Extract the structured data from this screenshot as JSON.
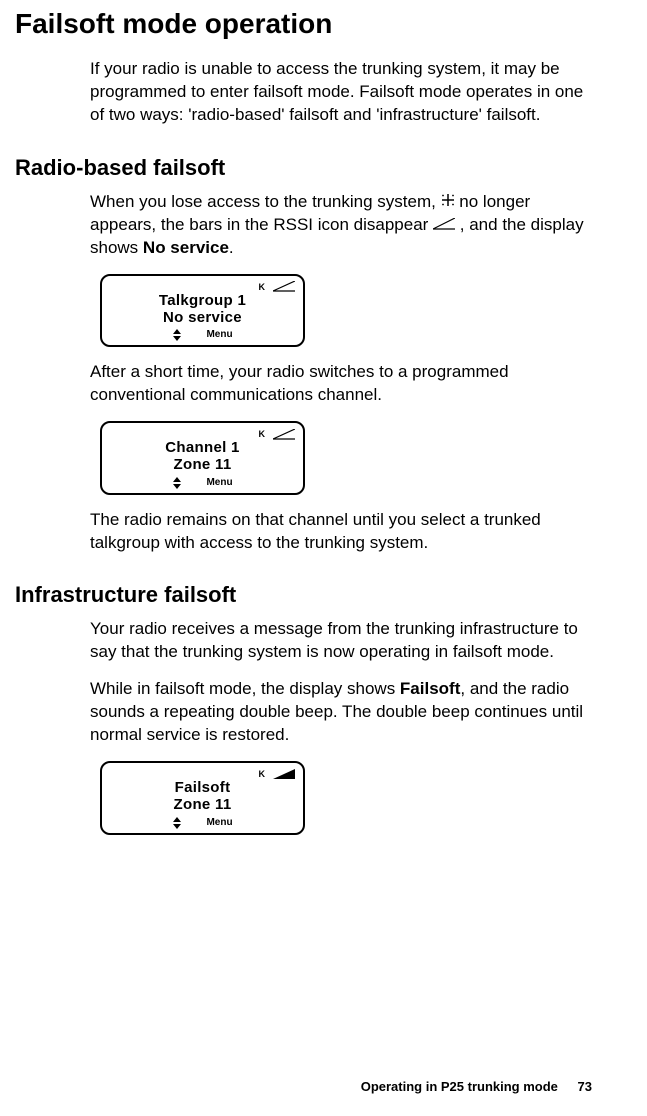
{
  "heading_main": "Failsoft mode operation",
  "intro_paragraph": "If your radio is unable to access the trunking system, it may be programmed to enter failsoft mode. Failsoft mode operates in one of two ways: 'radio-based' failsoft and 'infrastructure' failsoft.",
  "section1": {
    "heading": "Radio-based failsoft",
    "p1_pre": "When you lose access to the trunking system, ",
    "p1_mid": " no longer appears, the bars in the RSSI icon disappear ",
    "p1_post_pre": ", and the display shows ",
    "p1_bold": "No service",
    "p1_end": ".",
    "display1": {
      "status_k": "K",
      "line1": "Talkgroup 1",
      "line2": "No service",
      "menu": "Menu"
    },
    "p2": "After a short time, your radio switches to a programmed conventional communications channel.",
    "display2": {
      "status_k": "K",
      "line1": "Channel 1",
      "line2": "Zone 11",
      "menu": "Menu"
    },
    "p3": "The radio remains on that channel until you select a trunked talkgroup with access to the trunking system."
  },
  "section2": {
    "heading": "Infrastructure failsoft",
    "p1": "Your radio receives a message from the trunking infrastructure to say that the trunking system is now operating in failsoft mode.",
    "p2_pre": "While in failsoft mode, the display shows ",
    "p2_bold": "Failsoft",
    "p2_post": ", and the radio sounds a repeating double beep. The double beep continues until normal service is restored.",
    "display1": {
      "status_k": "K",
      "line1": "Failsoft",
      "line2": "Zone 11",
      "menu": "Menu"
    }
  },
  "footer": {
    "section_name": "Operating in P25 trunking mode",
    "page_number": "73"
  }
}
